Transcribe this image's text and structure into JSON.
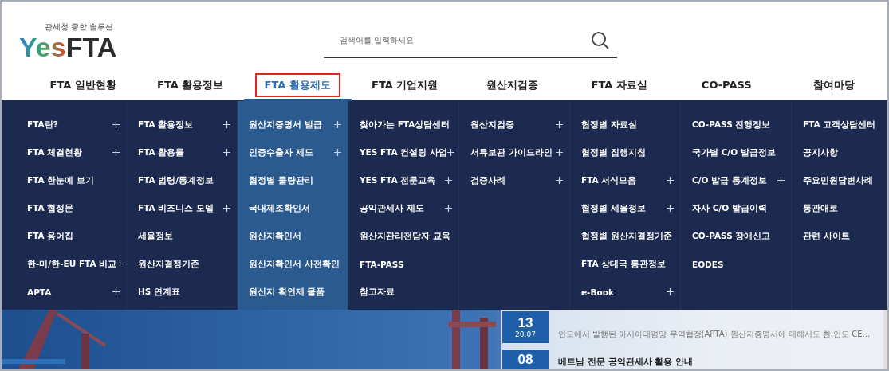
{
  "logo": {
    "tagline": "관세청 종합 솔루션",
    "brand_prefix": "Yes",
    "brand": "FTA"
  },
  "search": {
    "placeholder": "검색어를 입력하세요"
  },
  "nav": [
    {
      "label": "FTA 일반현황",
      "selected": false
    },
    {
      "label": "FTA 활용정보",
      "selected": false
    },
    {
      "label": "FTA 활용제도",
      "selected": true
    },
    {
      "label": "FTA 기업지원",
      "selected": false
    },
    {
      "label": "원산지검증",
      "selected": false
    },
    {
      "label": "FTA 자료실",
      "selected": false
    },
    {
      "label": "CO-PASS",
      "selected": false
    },
    {
      "label": "참여마당",
      "selected": false
    }
  ],
  "menu_columns": [
    {
      "selected": false,
      "items": [
        {
          "label": "FTA란?",
          "expandable": true
        },
        {
          "label": "FTA 체결현황",
          "expandable": true
        },
        {
          "label": "FTA 한눈에 보기",
          "expandable": false
        },
        {
          "label": "FTA 협정문",
          "expandable": false
        },
        {
          "label": "FTA 용어집",
          "expandable": false
        },
        {
          "label": "한-미/한-EU FTA 비교",
          "expandable": true
        },
        {
          "label": "APTA",
          "expandable": true
        }
      ]
    },
    {
      "selected": false,
      "items": [
        {
          "label": "FTA 활용정보",
          "expandable": true
        },
        {
          "label": "FTA 활용률",
          "expandable": true
        },
        {
          "label": "FTA 법령/통계정보",
          "expandable": false
        },
        {
          "label": "FTA 비즈니스 모델",
          "expandable": true
        },
        {
          "label": "세율정보",
          "expandable": false
        },
        {
          "label": "원산지결정기준",
          "expandable": false
        },
        {
          "label": "HS 연계표",
          "expandable": false
        }
      ]
    },
    {
      "selected": true,
      "items": [
        {
          "label": "원산지증명서 발급",
          "expandable": true
        },
        {
          "label": "인증수출자 제도",
          "expandable": true
        },
        {
          "label": "협정별 물량관리",
          "expandable": false
        },
        {
          "label": "국내제조확인서",
          "expandable": false
        },
        {
          "label": "원산지확인서",
          "expandable": false
        },
        {
          "label": "원산지확인서 사전확인",
          "expandable": false
        },
        {
          "label": "원산지 확인제 물품",
          "expandable": false
        }
      ]
    },
    {
      "selected": false,
      "items": [
        {
          "label": "찾아가는 FTA상담센터",
          "expandable": false
        },
        {
          "label": "YES FTA 컨설팅 사업",
          "expandable": true
        },
        {
          "label": "YES FTA 전문교육",
          "expandable": true
        },
        {
          "label": "공익관세사 제도",
          "expandable": true
        },
        {
          "label": "원산지관리전담자 교육",
          "expandable": false
        },
        {
          "label": "FTA-PASS",
          "expandable": false
        },
        {
          "label": "참고자료",
          "expandable": false
        }
      ]
    },
    {
      "selected": false,
      "items": [
        {
          "label": "원산지검증",
          "expandable": true
        },
        {
          "label": "서류보관 가이드라인",
          "expandable": true
        },
        {
          "label": "검증사례",
          "expandable": true
        }
      ]
    },
    {
      "selected": false,
      "items": [
        {
          "label": "협정별 자료실",
          "expandable": false
        },
        {
          "label": "협정별 집행지침",
          "expandable": false
        },
        {
          "label": "FTA 서식모음",
          "expandable": true
        },
        {
          "label": "협정별 세율정보",
          "expandable": true
        },
        {
          "label": "협정별 원산지결정기준",
          "expandable": false
        },
        {
          "label": "FTA 상대국 통관정보",
          "expandable": false
        },
        {
          "label": "e-Book",
          "expandable": true
        }
      ]
    },
    {
      "selected": false,
      "items": [
        {
          "label": "CO-PASS 진행정보",
          "expandable": false
        },
        {
          "label": "국가별 C/O 발급정보",
          "expandable": false
        },
        {
          "label": "C/O 발급 통계정보",
          "expandable": true
        },
        {
          "label": "자사 C/O 발급이력",
          "expandable": false
        },
        {
          "label": "CO-PASS 장애신고",
          "expandable": false
        },
        {
          "label": "EODES",
          "expandable": false
        }
      ]
    },
    {
      "selected": false,
      "items": [
        {
          "label": "FTA 고객상담센터",
          "expandable": false
        },
        {
          "label": "공지사항",
          "expandable": false
        },
        {
          "label": "주요민원답변사례",
          "expandable": false
        },
        {
          "label": "통관애로",
          "expandable": false
        },
        {
          "label": "관련 사이트",
          "expandable": false
        }
      ]
    }
  ],
  "news": [
    {
      "day": "13",
      "date": "20.07",
      "summary": "인도에서 발행된 아시아태평양 무역협정(APTA) 원산지증명서에 대해서도 한·인도 CE..."
    },
    {
      "day": "08",
      "title": "베트남 전문 공익관세사 활용 안내"
    }
  ]
}
